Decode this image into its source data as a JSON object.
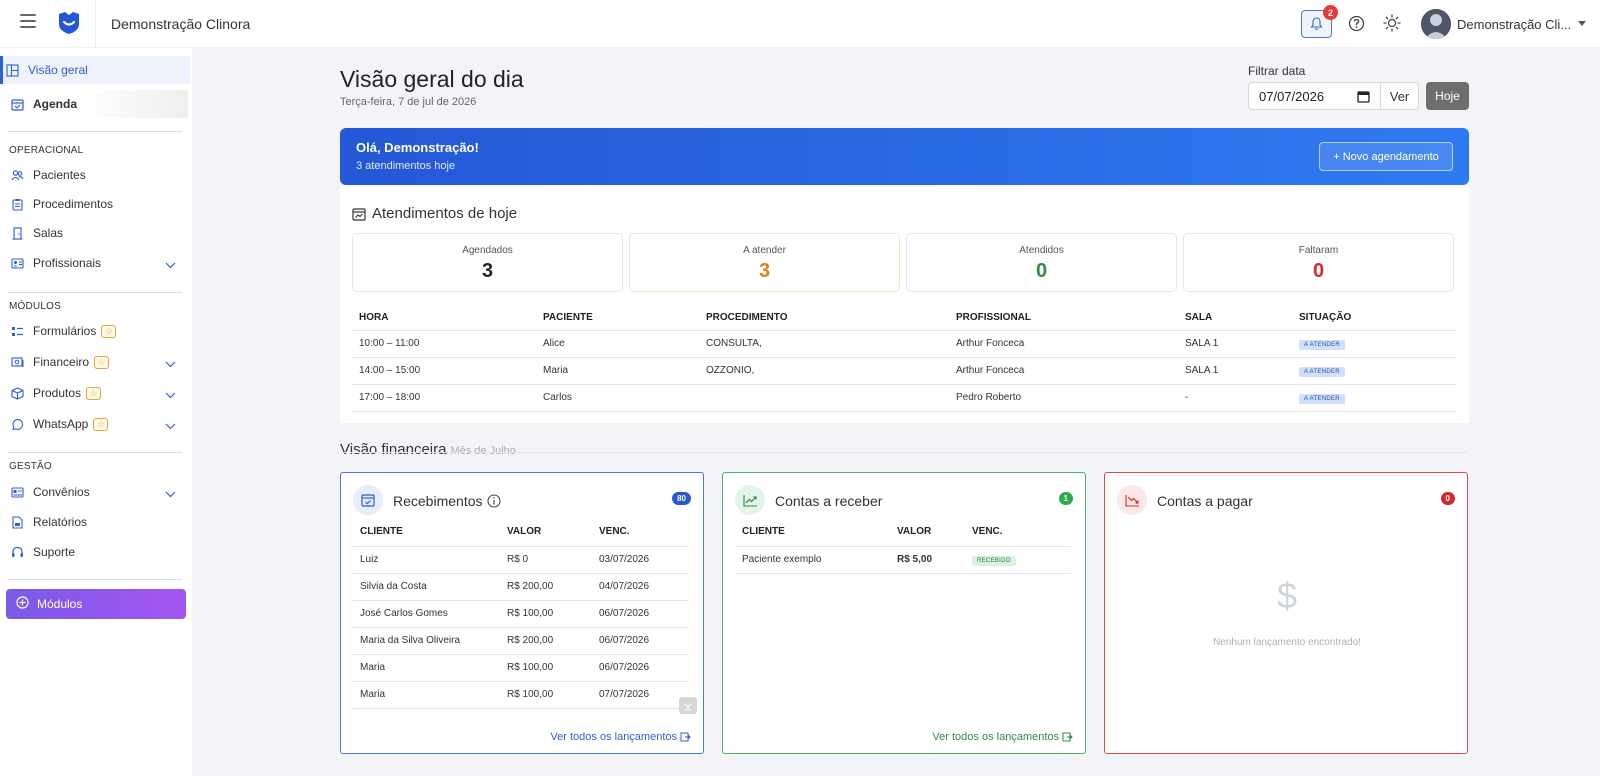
{
  "app": {
    "title": "Demonstração Clinora",
    "notifications": "2",
    "user": "Demonstração Cli..."
  },
  "colors": {
    "primary": "#2f5fd6",
    "blue_card": "#4a78d4",
    "green_card": "#4caf6a",
    "red_card": "#d84a4a",
    "purple": "#8b5cf6"
  },
  "sidebar": {
    "top": [
      {
        "label": "Visão geral",
        "icon": "layout-icon",
        "active": true
      },
      {
        "label": "Agenda",
        "icon": "calendar-icon"
      }
    ],
    "section_operacional": "OPERACIONAL",
    "operacional": [
      {
        "label": "Pacientes",
        "icon": "users-icon"
      },
      {
        "label": "Procedimentos",
        "icon": "clipboard-icon"
      },
      {
        "label": "Salas",
        "icon": "door-icon"
      },
      {
        "label": "Profissionais",
        "icon": "id-card-icon"
      }
    ],
    "section_modulos": "MÓDULOS",
    "modulos": [
      {
        "label": "Formulários",
        "icon": "list-icon"
      },
      {
        "label": "Financeiro",
        "icon": "money-icon"
      },
      {
        "label": "Produtos",
        "icon": "box-icon"
      },
      {
        "label": "WhatsApp",
        "icon": "whatsapp-icon"
      }
    ],
    "section_gestao": "GESTÃO",
    "gestao": [
      {
        "label": "Convênios",
        "icon": "card-icon"
      },
      {
        "label": "Relatórios",
        "icon": "report-icon"
      },
      {
        "label": "Suporte",
        "icon": "headset-icon"
      }
    ],
    "modules_button": "Módulos"
  },
  "page": {
    "title": "Visão geral do dia",
    "subtitle": "Terça-feira, 7 de jul de 2026",
    "filter_label": "Filtrar data",
    "date_value": "07/07/2026",
    "ver_button": "Ver",
    "hoje_button": "Hoje"
  },
  "banner": {
    "greeting": "Olá, Demonstração!",
    "count": "3 atendimentos hoje",
    "button": "+ Novo agendamento"
  },
  "atendimentos": {
    "title": "Atendimentos de hoje",
    "stats": [
      {
        "label": "Agendados",
        "value": "3",
        "color": "#222222"
      },
      {
        "label": "A atender",
        "value": "3",
        "color": "#d6841c"
      },
      {
        "label": "Atendidos",
        "value": "0",
        "color": "#2e8b47"
      },
      {
        "label": "Faltaram",
        "value": "0",
        "color": "#d12b2b"
      }
    ],
    "columns": [
      "HORA",
      "PACIENTE",
      "PROCEDIMENTO",
      "PROFISSIONAL",
      "SALA",
      "SITUAÇÃO"
    ],
    "rows": [
      {
        "hora": "10:00 – 11:00",
        "paciente": "Alice",
        "procedimento": "CONSULTA,",
        "profissional": "Arthur Fonceca",
        "sala": "SALA 1",
        "situacao": "A ATENDER"
      },
      {
        "hora": "14:00 – 15:00",
        "paciente": "Maria",
        "procedimento": "OZZONIO,",
        "profissional": "Arthur Fonceca",
        "sala": "SALA 1",
        "situacao": "A ATENDER"
      },
      {
        "hora": "17:00 – 18:00",
        "paciente": "Carlos",
        "procedimento": "",
        "profissional": "Pedro Roberto",
        "sala": "-",
        "situacao": "A ATENDER"
      }
    ]
  },
  "financeiro": {
    "title": "Visão financeira",
    "month": "Mês de Julho",
    "recebimentos": {
      "title": "Recebimentos",
      "badge": "80",
      "columns": [
        "CLIENTE",
        "VALOR",
        "VENC."
      ],
      "rows": [
        {
          "cliente": "Luiz",
          "valor": "R$ 0",
          "venc": "03/07/2026",
          "overdue": true
        },
        {
          "cliente": "Silvia da Costa",
          "valor": "R$ 200,00",
          "venc": "04/07/2026",
          "overdue": true
        },
        {
          "cliente": "José Carlos Gomes",
          "valor": "R$ 100,00",
          "venc": "06/07/2026",
          "overdue": true
        },
        {
          "cliente": "Maria da Silva Oliveira",
          "valor": "R$ 200,00",
          "venc": "06/07/2026",
          "overdue": true
        },
        {
          "cliente": "Maria",
          "valor": "R$ 100,00",
          "venc": "06/07/2026",
          "overdue": true
        },
        {
          "cliente": "Maria",
          "valor": "R$ 100,00",
          "venc": "07/07/2026",
          "overdue": false
        }
      ],
      "link": "Ver todos os lançamentos"
    },
    "contas_receber": {
      "title": "Contas a receber",
      "badge": "1",
      "columns": [
        "CLIENTE",
        "VALOR",
        "VENC."
      ],
      "rows": [
        {
          "cliente": "Paciente exemplo",
          "valor": "R$ 5,00",
          "status": "RECEBIDO"
        }
      ],
      "link": "Ver todos os lançamentos"
    },
    "contas_pagar": {
      "title": "Contas a pagar",
      "badge": "0",
      "empty_icon": "$",
      "empty_text": "Nenhum lançamento encontrado!"
    }
  }
}
